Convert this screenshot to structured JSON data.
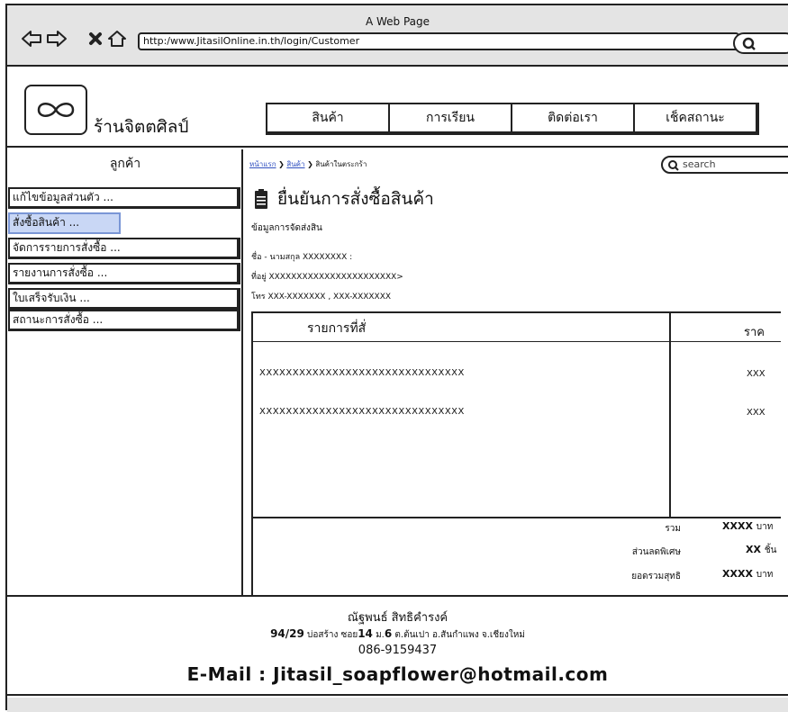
{
  "window": {
    "title": "A Web Page"
  },
  "browser": {
    "url": "http:/www.JitasilOnline.in.th/login/Customer",
    "icons": [
      "back-arrow-icon",
      "forward-arrow-icon",
      "close-x-icon",
      "home-icon",
      "search-icon"
    ]
  },
  "header": {
    "logo_icon": "infinity-icon",
    "shop_name": "ร้านจิตตศิลป์",
    "nav": [
      "สินค้า",
      "การเรียน",
      "ติดต่อเรา",
      "เช็คสถานะ"
    ]
  },
  "sidebar": {
    "title": "ลูกค้า",
    "items": [
      {
        "label": "แก้ไขข้อมูลส่วนตัว   ..."
      },
      {
        "label": "สั่งซื้อสินค้า   ..."
      },
      {
        "label": "จัดการรายการสั่งซื้อ   ..."
      },
      {
        "label": "รายงานการสั่งซื้อ   ..."
      },
      {
        "label": "ใบเสร็จรับเงิน   ..."
      },
      {
        "label": "สถานะการสั่งซื้อ   ..."
      }
    ]
  },
  "main": {
    "breadcrumb": [
      "หน้าแรก",
      "สินค้า",
      "สินค้าในตระกร้า"
    ],
    "search_placeholder": "search",
    "page_title": "ยื่นยันการสั่งซื้อสินค้า",
    "shipping_heading": "ข้อมูลการจัดส่งสิน",
    "shipping_lines": [
      "ชื่อ - นามสกุล  XXXXXXXX :",
      "ที่อยู่  XXXXXXXXXXXXXXXXXXXXXXX>",
      "โทร  XXX-XXXXXXX , XXX-XXXXXXX"
    ],
    "table": {
      "col_item": "รายการที่สั่",
      "col_price": "ราค",
      "rows": [
        {
          "item": "XXXXXXXXXXXXXXXXXXXXXXXXXXXXXXX",
          "price": "XXX"
        },
        {
          "item": "XXXXXXXXXXXXXXXXXXXXXXXXXXXXXXX",
          "price": "XXX"
        }
      ]
    },
    "summary": {
      "total_label": "รวม",
      "total_value": "XXXX",
      "total_unit": "บาท",
      "discount_label": "ส่วนลดพิเศษ",
      "discount_value": "XX",
      "discount_unit": "ชิ้น",
      "net_label": "ยอดรวมสุทธิ",
      "net_value": "XXXX",
      "net_unit": "บาท"
    }
  },
  "footer": {
    "name": "ณัฐพนธ์ สิทธิคำรงค์",
    "address_no": "94/29",
    "address_part1": "บ่อสร้าง ซอย",
    "soi": "14",
    "address_part2": "ม.",
    "moo": "6",
    "address_part3": "ต.ต้นเปา อ.สันกำแพง จ.เชียงใหม่",
    "phone": "086-9159437",
    "email": "E-Mail : Jitasil_soapflower@hotmail.com"
  }
}
